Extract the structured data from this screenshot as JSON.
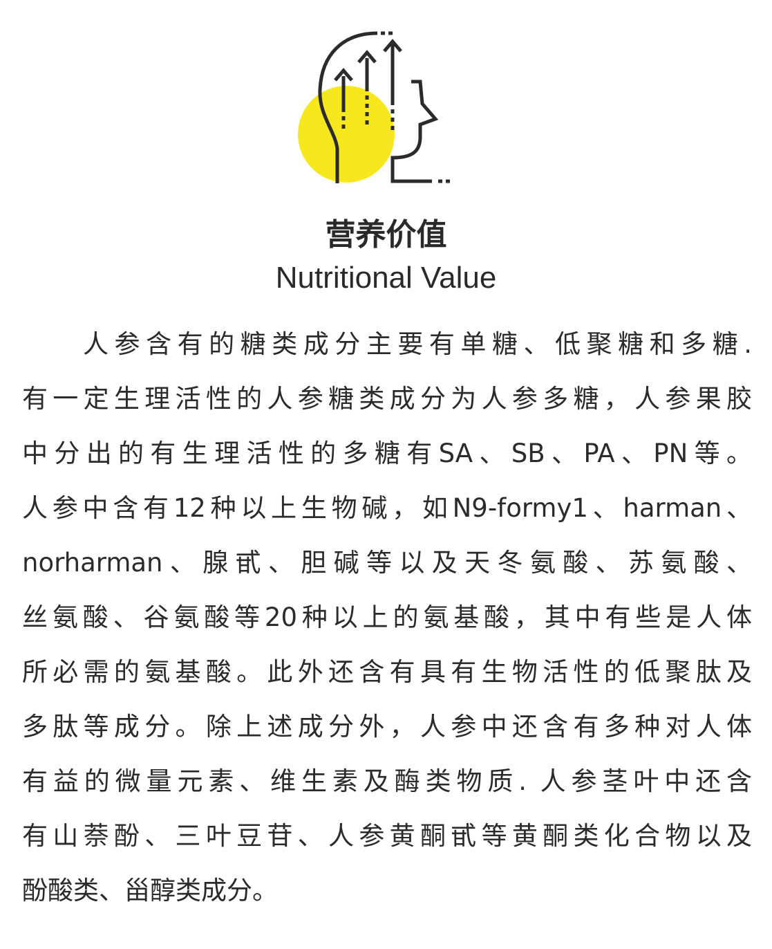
{
  "header": {
    "icon": "head-with-rising-arrows-icon",
    "accent_color": "#f7e81e",
    "line_color": "#2b2b2b"
  },
  "title": {
    "cn": "营养价值",
    "en": "Nutritional Value"
  },
  "body": {
    "lines": [
      "人参含有的糖类成分主要有单糖、低聚糖和多糖.",
      "有一定生理活性的人参糖类成分为人参多糖，人参果胶",
      "中分出的有生理活性的多糖有SA、SB、PA、PN等。",
      "人参中含有12种以上生物碱，如N9-formy1、harman、",
      "norharman、腺甙、胆碱等以及天冬氨酸、苏氨酸、",
      "丝氨酸、谷氨酸等20种以上的氨基酸，其中有些是人体",
      "所必需的氨基酸。此外还含有具有生物活性的低聚肽及",
      "多肽等成分。除上述成分外，人参中还含有多种对人体",
      "有益的微量元素、维生素及酶类物质. 人参茎叶中还含",
      "有山萘酚、三叶豆苷、人参黄酮甙等黄酮类化合物以及",
      "酚酸类、甾醇类成分。"
    ]
  }
}
